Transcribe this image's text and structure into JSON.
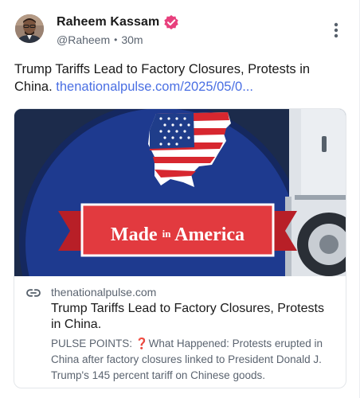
{
  "post": {
    "author": {
      "display_name": "Raheem Kassam",
      "handle": "@Raheem",
      "separator": "•",
      "timestamp": "30m",
      "avatar_icon": "profile-photo",
      "verified_icon": "verified-badge-icon",
      "verified_color": "#e8407d"
    },
    "more_icon": "kebab-menu-icon",
    "text": "Trump Tariffs Lead to Factory Closures, Protests in China.",
    "link_text": "thenationalpulse.com/2025/05/0...",
    "link_color": "#4a6fe3",
    "card": {
      "image_caption": "Made in America",
      "image_caption_parts": [
        "Made",
        "in",
        "America"
      ],
      "link_icon": "link-icon",
      "domain": "thenationalpulse.com",
      "title": "Trump Tariffs Lead to Factory Closures, Protests in China.",
      "description": "PULSE POINTS: ❓What Happened: Protests erupted in China after factory closures linked to President Donald J. Trump's 145 percent tariff on Chinese goods."
    }
  }
}
